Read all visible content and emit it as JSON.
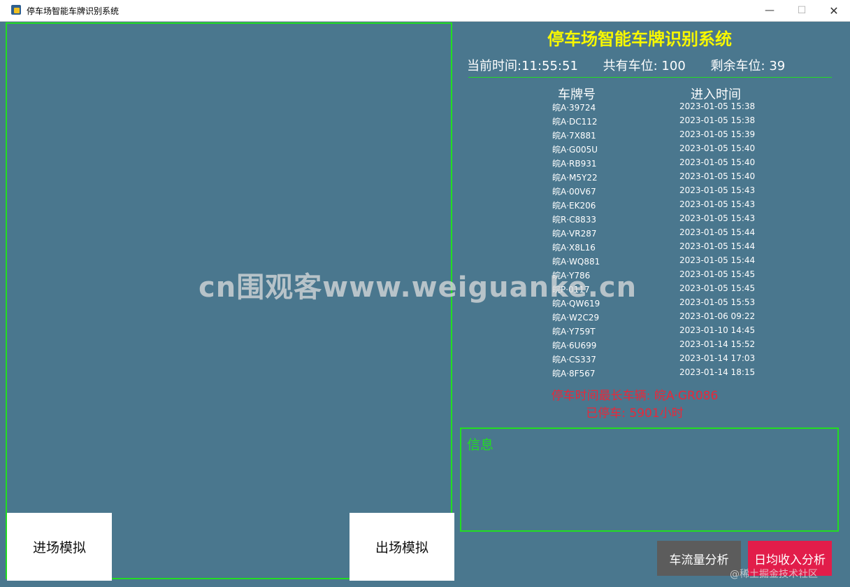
{
  "window": {
    "title": "停车场智能车牌识别系统",
    "controls": {
      "minimize": "—",
      "maximize": "☐",
      "close": "✕"
    }
  },
  "colors": {
    "background": "#4a778e",
    "accent_green": "#22dd22",
    "title_yellow": "#f7f700",
    "warning_red": "#e8283a",
    "income_button": "#e21d4a",
    "flow_button": "#5c5c5c"
  },
  "header": {
    "title": "停车场智能车牌识别系统",
    "current_time": "当前时间:11:55:51",
    "total_spaces": "共有车位: 100",
    "remaining_spaces": "剩余车位: 39"
  },
  "table": {
    "columns": [
      "车牌号",
      "进入时间"
    ],
    "rows": [
      {
        "plate": "皖A·39724",
        "time": "2023-01-05 15:38"
      },
      {
        "plate": "皖A·DC112",
        "time": "2023-01-05 15:38"
      },
      {
        "plate": "皖A·7X881",
        "time": "2023-01-05 15:39"
      },
      {
        "plate": "皖A·G005U",
        "time": "2023-01-05 15:40"
      },
      {
        "plate": "皖A·RB931",
        "time": "2023-01-05 15:40"
      },
      {
        "plate": "皖A·M5Y22",
        "time": "2023-01-05 15:40"
      },
      {
        "plate": "皖A·00V67",
        "time": "2023-01-05 15:43"
      },
      {
        "plate": "皖A·EK206",
        "time": "2023-01-05 15:43"
      },
      {
        "plate": "皖R·C8833",
        "time": "2023-01-05 15:43"
      },
      {
        "plate": "皖A·VR287",
        "time": "2023-01-05 15:44"
      },
      {
        "plate": "皖A·X8L16",
        "time": "2023-01-05 15:44"
      },
      {
        "plate": "皖A·WQ881",
        "time": "2023-01-05 15:44"
      },
      {
        "plate": "皖A·Y786",
        "time": "2023-01-05 15:45"
      },
      {
        "plate": "皖P·0117",
        "time": "2023-01-05 15:45"
      },
      {
        "plate": "皖A·QW619",
        "time": "2023-01-05 15:53"
      },
      {
        "plate": "皖A·W2C29",
        "time": "2023-01-06 09:22"
      },
      {
        "plate": "皖A·Y759T",
        "time": "2023-01-10 14:45"
      },
      {
        "plate": "皖A·6U699",
        "time": "2023-01-14 15:52"
      },
      {
        "plate": "皖A·CS337",
        "time": "2023-01-14 17:03"
      },
      {
        "plate": "皖A·8F567",
        "time": "2023-01-14 18:15"
      }
    ]
  },
  "longest": {
    "vehicle": "停车时间最长车辆: 皖A·GR086",
    "duration": "已停车: 5901小时"
  },
  "info": {
    "label": "信息"
  },
  "buttons": {
    "enter": "进场模拟",
    "exit": "出场模拟",
    "flow_analysis": "车流量分析",
    "income_analysis": "日均收入分析"
  },
  "watermark": "cn围观客www.weiguanke.cn",
  "corner_watermark": "@稀土掘金技术社区"
}
